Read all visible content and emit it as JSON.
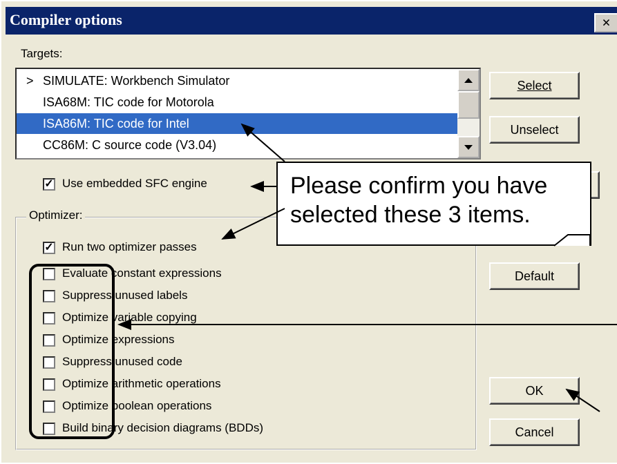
{
  "dialog": {
    "title": "Compiler options",
    "close_label": "×"
  },
  "targets": {
    "label": "Targets:",
    "items": [
      {
        "marker": ">",
        "label": "SIMULATE: Workbench Simulator"
      },
      {
        "marker": "",
        "label": "ISA68M: TIC code for Motorola"
      },
      {
        "marker": "",
        "label": "ISA86M: TIC code for Intel",
        "selected": true
      },
      {
        "marker": "",
        "label": "CC86M: C source code (V3.04)"
      }
    ]
  },
  "buttons": {
    "select": "Select",
    "unselect": "Unselect",
    "default": "Default",
    "ok": "OK",
    "cancel": "Cancel"
  },
  "embedded_sfc": {
    "label": "Use embedded SFC engine",
    "checked": true
  },
  "optimizer": {
    "label": "Optimizer:",
    "options": [
      {
        "label": "Run two optimizer passes",
        "checked": true
      },
      {
        "label": "Evaluate constant expressions",
        "checked": false
      },
      {
        "label": "Suppress unused labels",
        "checked": false
      },
      {
        "label": "Optimize variable copying",
        "checked": false
      },
      {
        "label": "Optimize expressions",
        "checked": false
      },
      {
        "label": "Suppress unused code",
        "checked": false
      },
      {
        "label": "Optimize arithmetic operations",
        "checked": false
      },
      {
        "label": "Optimize boolean operations",
        "checked": false
      },
      {
        "label": "Build binary decision diagrams (BDDs)",
        "checked": false
      }
    ]
  },
  "callout": {
    "line1": "Please confirm you have",
    "line2": "selected these 3 items."
  },
  "colors": {
    "titlebar": "#0a246a",
    "selection": "#316ac5",
    "face": "#ece9d8"
  }
}
